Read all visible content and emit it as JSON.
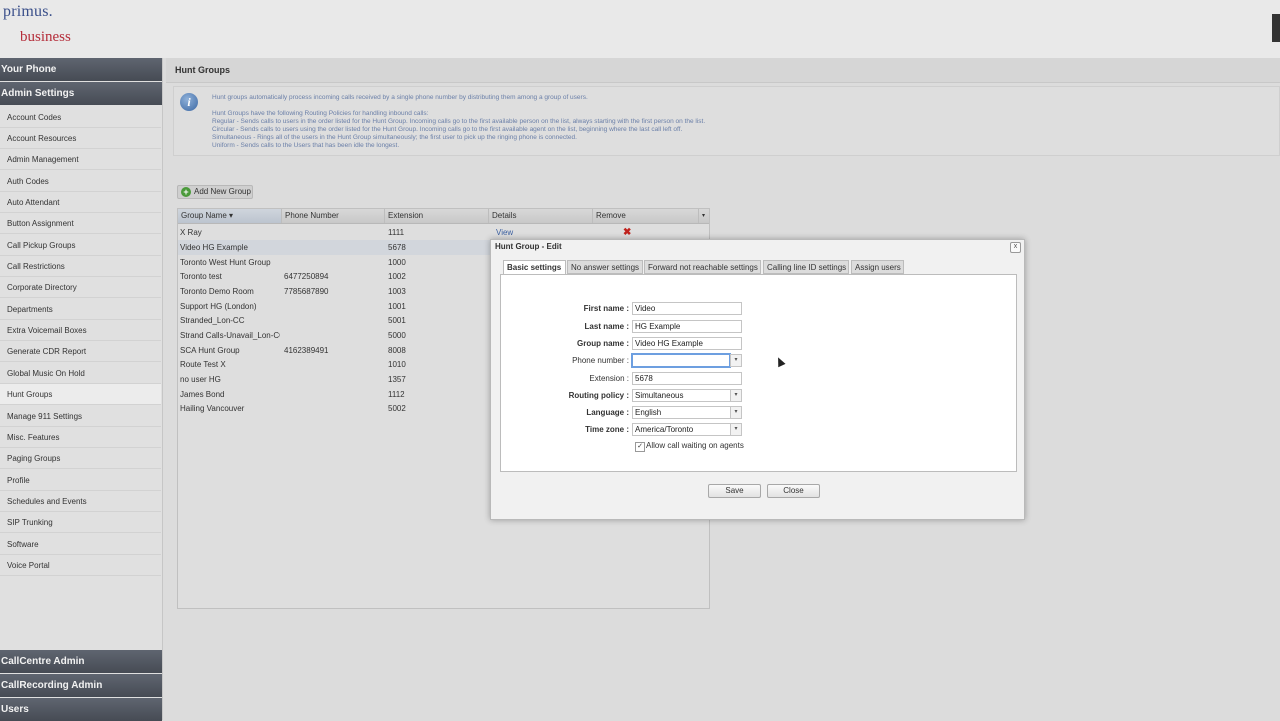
{
  "brand": {
    "line1": "primus.",
    "line2": "business"
  },
  "sidebar": {
    "sections_top": [
      "Your Phone",
      "Admin Settings"
    ],
    "items": [
      "Account Codes",
      "Account Resources",
      "Admin Management",
      "Auth Codes",
      "Auto Attendant",
      "Button Assignment",
      "Call Pickup Groups",
      "Call Restrictions",
      "Corporate Directory",
      "Departments",
      "Extra Voicemail Boxes",
      "Generate CDR Report",
      "Global Music On Hold",
      "Hunt Groups",
      "Manage 911 Settings",
      "Misc. Features",
      "Paging Groups",
      "Profile",
      "Schedules and Events",
      "SIP Trunking",
      "Software",
      "Voice Portal"
    ],
    "active_item": "Hunt Groups",
    "sections_bottom": [
      "CallCentre Admin",
      "CallRecording Admin",
      "Users"
    ]
  },
  "main": {
    "title": "Hunt Groups",
    "info_lines": [
      "Hunt groups automatically process incoming calls received by a single phone number by distributing them among a group of users.",
      "Hunt Groups have the following Routing Policies for handling inbound calls:",
      "Regular - Sends calls to users in the order listed for the Hunt Group. Incoming calls go to the first available person on the list, always starting with the first person on the list.",
      "Circular - Sends calls to users using the order listed for the Hunt Group. Incoming calls go to the first available agent on the list, beginning where the last call left off.",
      "Simultaneous - Rings all of the users in the Hunt Group simultaneously; the first user to pick up the ringing phone is connected.",
      "Uniform - Sends calls to the Users that has been idle the longest."
    ],
    "add_button": "Add New Group",
    "columns": [
      "Group Name",
      "Phone Number",
      "Extension",
      "Details",
      "Remove"
    ],
    "rows": [
      {
        "name": "X Ray",
        "phone": "",
        "ext": "1111",
        "details": "View",
        "remove": "✖"
      },
      {
        "name": "Video HG Example",
        "phone": "",
        "ext": "5678",
        "details": "",
        "remove": ""
      },
      {
        "name": "Toronto West Hunt Group",
        "phone": "",
        "ext": "1000",
        "details": "",
        "remove": ""
      },
      {
        "name": "Toronto test",
        "phone": "6477250894",
        "ext": "1002",
        "details": "",
        "remove": ""
      },
      {
        "name": "Toronto Demo Room",
        "phone": "7785687890",
        "ext": "1003",
        "details": "",
        "remove": ""
      },
      {
        "name": "Support HG (London)",
        "phone": "",
        "ext": "1001",
        "details": "",
        "remove": ""
      },
      {
        "name": "Stranded_Lon-CC",
        "phone": "",
        "ext": "5001",
        "details": "",
        "remove": ""
      },
      {
        "name": "Strand Calls-Unavail_Lon-CC",
        "phone": "",
        "ext": "5000",
        "details": "",
        "remove": ""
      },
      {
        "name": "SCA Hunt Group",
        "phone": "4162389491",
        "ext": "8008",
        "details": "",
        "remove": ""
      },
      {
        "name": "Route Test X",
        "phone": "",
        "ext": "1010",
        "details": "",
        "remove": ""
      },
      {
        "name": "no user HG",
        "phone": "",
        "ext": "1357",
        "details": "",
        "remove": ""
      },
      {
        "name": "James Bond",
        "phone": "",
        "ext": "1112",
        "details": "",
        "remove": ""
      },
      {
        "name": "Hailing Vancouver",
        "phone": "",
        "ext": "5002",
        "details": "",
        "remove": ""
      }
    ]
  },
  "dialog": {
    "title": "Hunt Group - Edit",
    "close_glyph": "x",
    "tabs": [
      "Basic settings",
      "No answer settings",
      "Forward not reachable settings",
      "Calling line ID settings",
      "Assign users"
    ],
    "fields": {
      "first_name": {
        "label": "First name :",
        "value": "Video"
      },
      "last_name": {
        "label": "Last name :",
        "value": "HG Example"
      },
      "group_name": {
        "label": "Group name :",
        "value": "Video HG Example"
      },
      "phone_number": {
        "label": "Phone number :",
        "value": ""
      },
      "extension": {
        "label": "Extension :",
        "value": "5678"
      },
      "routing_policy": {
        "label": "Routing policy :",
        "value": "Simultaneous"
      },
      "language": {
        "label": "Language :",
        "value": "English"
      },
      "time_zone": {
        "label": "Time zone :",
        "value": "America/Toronto"
      }
    },
    "checkbox": {
      "label": "Allow call waiting on agents",
      "checked": true
    },
    "save": "Save",
    "close": "Close"
  }
}
